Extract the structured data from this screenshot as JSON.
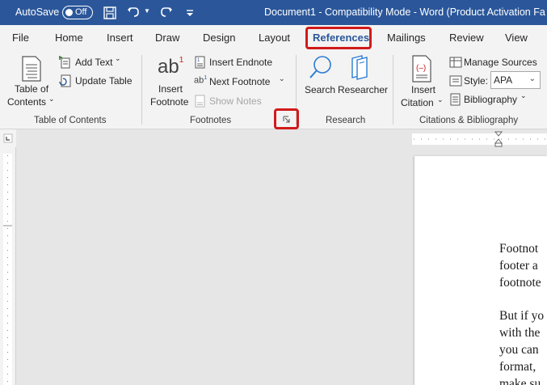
{
  "titlebar": {
    "autosave_label": "AutoSave",
    "autosave_state": "Off",
    "document_title": "Document1  -  Compatibility Mode  -  Word (Product Activation Fa",
    "background_color": "#2b579a"
  },
  "tabs": [
    "File",
    "Home",
    "Insert",
    "Draw",
    "Design",
    "Layout",
    "References",
    "Mailings",
    "Review",
    "View"
  ],
  "selected_tab": "References",
  "ribbon": {
    "toc": {
      "table_of_contents_line1": "Table of",
      "table_of_contents_line2": "Contents",
      "add_text": "Add Text",
      "update_table": "Update Table",
      "group_label": "Table of Contents"
    },
    "footnotes": {
      "insert_footnote_line1": "Insert",
      "insert_footnote_line2": "Footnote",
      "insert_endnote": "Insert Endnote",
      "next_footnote": "Next Footnote",
      "show_notes": "Show Notes",
      "group_label": "Footnotes"
    },
    "research": {
      "search": "Search",
      "researcher": "Researcher",
      "group_label": "Research"
    },
    "citations": {
      "insert_citation_line1": "Insert",
      "insert_citation_line2": "Citation",
      "manage_sources": "Manage Sources",
      "style_label": "Style:",
      "style_value": "APA",
      "bibliography": "Bibliography",
      "group_label": "Citations & Bibliography"
    }
  },
  "document": {
    "lines": [
      "Footnot",
      "footer a",
      "footnote",
      "But if yo",
      "with the",
      "you can",
      "format,",
      "make su"
    ]
  },
  "highlight_color": "#d11a1a"
}
